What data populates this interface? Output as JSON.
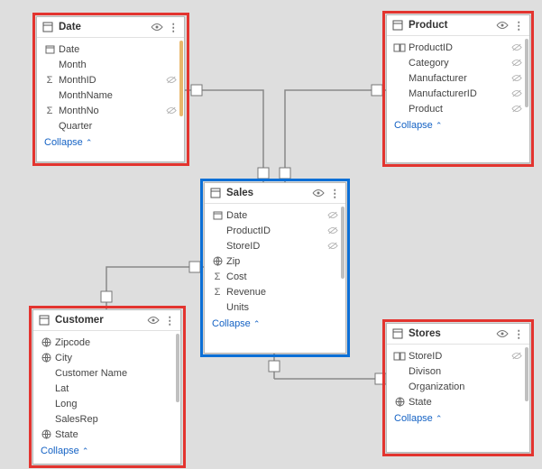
{
  "collapse_label": "Collapse",
  "tables": {
    "date": {
      "title": "Date",
      "fields": [
        {
          "icon": "calendar",
          "label": "Date",
          "hidden": false
        },
        {
          "icon": null,
          "label": "Month",
          "hidden": false
        },
        {
          "icon": "sigma",
          "label": "MonthID",
          "hidden": true
        },
        {
          "icon": null,
          "label": "MonthName",
          "hidden": false
        },
        {
          "icon": "sigma",
          "label": "MonthNo",
          "hidden": true
        },
        {
          "icon": null,
          "label": "Quarter",
          "hidden": false
        }
      ]
    },
    "product": {
      "title": "Product",
      "fields": [
        {
          "icon": "key",
          "label": "ProductID",
          "hidden": true
        },
        {
          "icon": null,
          "label": "Category",
          "hidden": true
        },
        {
          "icon": null,
          "label": "Manufacturer",
          "hidden": true
        },
        {
          "icon": null,
          "label": "ManufacturerID",
          "hidden": true
        },
        {
          "icon": null,
          "label": "Product",
          "hidden": true
        }
      ]
    },
    "sales": {
      "title": "Sales",
      "fields": [
        {
          "icon": "calendar",
          "label": "Date",
          "hidden": true
        },
        {
          "icon": null,
          "label": "ProductID",
          "hidden": true
        },
        {
          "icon": null,
          "label": "StoreID",
          "hidden": true
        },
        {
          "icon": "globe",
          "label": "Zip",
          "hidden": false
        },
        {
          "icon": "sigma",
          "label": "Cost",
          "hidden": false
        },
        {
          "icon": "sigma",
          "label": "Revenue",
          "hidden": false
        },
        {
          "icon": null,
          "label": "Units",
          "hidden": false
        }
      ]
    },
    "customer": {
      "title": "Customer",
      "fields": [
        {
          "icon": "globe",
          "label": "Zipcode",
          "hidden": false
        },
        {
          "icon": "globe",
          "label": "City",
          "hidden": false
        },
        {
          "icon": null,
          "label": "Customer Name",
          "hidden": false
        },
        {
          "icon": null,
          "label": "Lat",
          "hidden": false
        },
        {
          "icon": null,
          "label": "Long",
          "hidden": false
        },
        {
          "icon": null,
          "label": "SalesRep",
          "hidden": false
        },
        {
          "icon": "globe",
          "label": "State",
          "hidden": false
        }
      ]
    },
    "stores": {
      "title": "Stores",
      "fields": [
        {
          "icon": "key",
          "label": "StoreID",
          "hidden": true
        },
        {
          "icon": null,
          "label": "Divison",
          "hidden": false
        },
        {
          "icon": null,
          "label": "Organization",
          "hidden": false
        },
        {
          "icon": "globe",
          "label": "State",
          "hidden": false
        }
      ]
    }
  }
}
